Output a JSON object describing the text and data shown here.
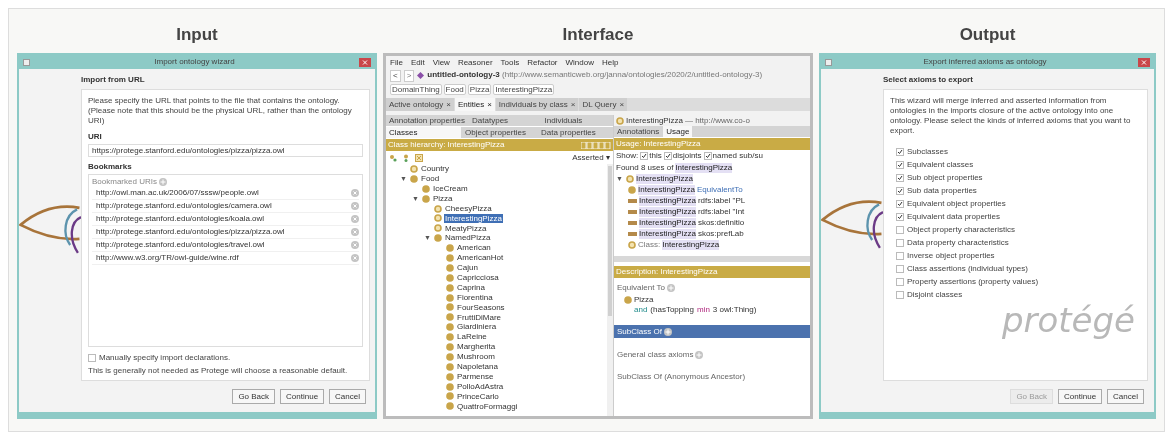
{
  "input": {
    "heading": "Input",
    "window": {
      "title": "Import ontology wizard",
      "section_title": "Import from URL",
      "intro": "Please specify the URL that points to the file that contains the ontology. (Please note that this should be the physical URL, rather than the ontology URI)",
      "uri_label": "URI",
      "uri_value": "https://protege.stanford.edu/ontologies/pizza/pizza.owl",
      "bookmarks_label": "Bookmarks",
      "bookmarks_sublabel": "Bookmarked URIs",
      "bookmarks": [
        "http://owl.man.ac.uk/2006/07/sssw/people.owl",
        "http://protege.stanford.edu/ontologies/camera.owl",
        "http://protege.stanford.edu/ontologies/koala.owl",
        "http://protege.stanford.edu/ontologies/pizza/pizza.owl",
        "http://protege.stanford.edu/ontologies/travel.owl",
        "http://www.w3.org/TR/owl-guide/wine.rdf"
      ],
      "manual": {
        "label": "Manually specify import declarations.",
        "checked": false
      },
      "note": "This is generally not needed as Protege will choose a reasonable default.",
      "buttons": [
        {
          "label": "Go Back",
          "disabled": false
        },
        {
          "label": "Continue",
          "disabled": false
        },
        {
          "label": "Cancel",
          "disabled": false
        }
      ]
    }
  },
  "interface": {
    "heading": "Interface",
    "menu": [
      "File",
      "Edit",
      "View",
      "Reasoner",
      "Tools",
      "Refactor",
      "Window",
      "Help"
    ],
    "back_label": "<",
    "forward_label": ">",
    "expanded_mark": "▼",
    "mode_caret": "▾",
    "ontology_name": "untitled-ontology-3",
    "ontology_iri": "(http://www.semanticweb.org/janna/ontologies/2020/2/untitled-ontology-3)",
    "breadcrumb": [
      "DomainThing",
      "Food",
      "Pizza",
      "InterestingPizza"
    ],
    "tabs": [
      {
        "label": "Active ontology",
        "selected": false
      },
      {
        "label": "Entities",
        "selected": true
      },
      {
        "label": "Individuals by class",
        "selected": false
      },
      {
        "label": "DL Query",
        "selected": false
      }
    ],
    "close_mark": "×",
    "entity_tabs_top": [
      {
        "label": "Annotation properties",
        "selected": false
      },
      {
        "label": "Datatypes",
        "selected": false
      },
      {
        "label": "Individuals",
        "selected": false
      }
    ],
    "entity_tabs_bottom": [
      {
        "label": "Classes",
        "selected": true
      },
      {
        "label": "Object properties",
        "selected": false
      },
      {
        "label": "Data properties",
        "selected": false
      }
    ],
    "hierarchy_title": "Class hierarchy: InterestingPizza",
    "hierarchy_mode": "Asserted",
    "tree": [
      {
        "label": "Country",
        "defined": true,
        "selected": false
      },
      {
        "label": "Food",
        "defined": false,
        "selected": false,
        "expanded": true,
        "children": [
          {
            "label": "IceCream",
            "defined": false,
            "selected": false
          },
          {
            "label": "Pizza",
            "defined": false,
            "selected": false,
            "expanded": true,
            "children": [
              {
                "label": "CheesyPizza",
                "defined": true,
                "selected": false
              },
              {
                "label": "InterestingPizza",
                "defined": true,
                "selected": true
              },
              {
                "label": "MeatyPizza",
                "defined": true,
                "selected": false
              },
              {
                "label": "NamedPizza",
                "defined": false,
                "selected": false,
                "expanded": true,
                "children": [
                  {
                    "label": "American",
                    "defined": false,
                    "selected": false
                  },
                  {
                    "label": "AmericanHot",
                    "defined": false,
                    "selected": false
                  },
                  {
                    "label": "Cajun",
                    "defined": false,
                    "selected": false
                  },
                  {
                    "label": "Capricciosa",
                    "defined": false,
                    "selected": false
                  },
                  {
                    "label": "Caprina",
                    "defined": false,
                    "selected": false
                  },
                  {
                    "label": "Fiorentina",
                    "defined": false,
                    "selected": false
                  },
                  {
                    "label": "FourSeasons",
                    "defined": false,
                    "selected": false
                  },
                  {
                    "label": "FruttiDiMare",
                    "defined": false,
                    "selected": false
                  },
                  {
                    "label": "Giardiniera",
                    "defined": false,
                    "selected": false
                  },
                  {
                    "label": "LaReine",
                    "defined": false,
                    "selected": false
                  },
                  {
                    "label": "Margherita",
                    "defined": false,
                    "selected": false
                  },
                  {
                    "label": "Mushroom",
                    "defined": false,
                    "selected": false
                  },
                  {
                    "label": "Napoletana",
                    "defined": false,
                    "selected": false
                  },
                  {
                    "label": "Parmense",
                    "defined": false,
                    "selected": false
                  },
                  {
                    "label": "PolloAdAstra",
                    "defined": false,
                    "selected": false
                  },
                  {
                    "label": "PrinceCarlo",
                    "defined": false,
                    "selected": false
                  },
                  {
                    "label": "QuattroFormaggi",
                    "defined": false,
                    "selected": false
                  }
                ]
              }
            ]
          }
        ]
      }
    ],
    "entity_title": "InterestingPizza",
    "entity_iri": "— http://www.co-o",
    "detail_tabs": [
      {
        "label": "Annotations",
        "selected": false
      },
      {
        "label": "Usage",
        "selected": true
      }
    ],
    "usage_title": "Usage: InterestingPizza",
    "show_label": "Show:",
    "show_options": [
      {
        "label": "this",
        "checked": true
      },
      {
        "label": "disjoints",
        "checked": true
      },
      {
        "label": "named sub/su",
        "checked": true
      }
    ],
    "found_prefix": "Found 8 uses of",
    "found_entity": "InterestingPizza",
    "usage_root": "InterestingPizza",
    "usages": [
      {
        "kind": "class",
        "subject": "InterestingPizza",
        "rest": "EquivalentTo"
      },
      {
        "kind": "annotation",
        "subject": "InterestingPizza",
        "rest": "rdfs:label \"PL"
      },
      {
        "kind": "annotation",
        "subject": "InterestingPizza",
        "rest": "rdfs:label \"Int"
      },
      {
        "kind": "annotation",
        "subject": "InterestingPizza",
        "rest": "skos:definitio"
      },
      {
        "kind": "annotation",
        "subject": "InterestingPizza",
        "rest": "skos:prefLab"
      },
      {
        "kind": "declaration",
        "subject": "InterestingPizza",
        "rest": "Class:"
      }
    ],
    "description_title": "Description: InterestingPizza",
    "equivalent_label": "Equivalent To",
    "equivalent_class": "Pizza",
    "equivalent_expr": [
      {
        "kind": "keyword",
        "text": "and"
      },
      {
        "kind": "plain",
        "text": "(hasTopping"
      },
      {
        "kind": "restriction",
        "text": "min"
      },
      {
        "kind": "plain",
        "text": "3 owl:Thing)"
      }
    ],
    "subclass_label": "SubClass Of",
    "general_label": "General class axioms",
    "ancestor_label": "SubClass Of (Anonymous Ancestor)"
  },
  "output": {
    "heading": "Output",
    "window": {
      "title": "Export inferred axioms as ontology",
      "section_title": "Select axioms to export",
      "logo_text": "protégé",
      "intro": "This wizard will merge inferred and asserted information from ontologies in the imports closure of the active ontology into one ontology. Please select the kinds of inferred axioms that you want to export.",
      "options": [
        {
          "label": "Subclasses",
          "checked": true
        },
        {
          "label": "Equivalent classes",
          "checked": true
        },
        {
          "label": "Sub object properties",
          "checked": true
        },
        {
          "label": "Sub data properties",
          "checked": true
        },
        {
          "label": "Equivalent object properties",
          "checked": true
        },
        {
          "label": "Equivalent data properties",
          "checked": true
        },
        {
          "label": "Object property characteristics",
          "checked": false
        },
        {
          "label": "Data property characteristics",
          "checked": false
        },
        {
          "label": "Inverse object properties",
          "checked": false
        },
        {
          "label": "Class assertions (individual types)",
          "checked": false
        },
        {
          "label": "Property assertions (property values)",
          "checked": false
        },
        {
          "label": "Disjoint classes",
          "checked": false
        }
      ],
      "buttons": [
        {
          "label": "Go Back",
          "disabled": true
        },
        {
          "label": "Continue",
          "disabled": false
        },
        {
          "label": "Cancel",
          "disabled": false
        }
      ]
    }
  }
}
